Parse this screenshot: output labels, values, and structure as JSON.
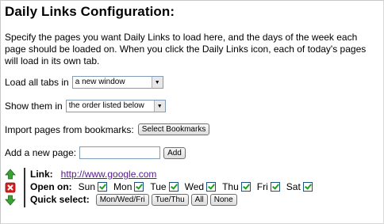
{
  "title": "Daily Links Configuration:",
  "description": "Specify the pages you want Daily Links to load here, and the days of the week each page should be loaded on. When you click the Daily Links icon, each of today's pages will load in its own tab.",
  "load_tabs": {
    "label": "Load all tabs in",
    "selected": "a new window"
  },
  "order": {
    "label": "Show them in",
    "selected": "the order listed below"
  },
  "import": {
    "label": "Import pages from bookmarks:",
    "button": "Select Bookmarks"
  },
  "add_page": {
    "label": "Add a new page:",
    "value": "",
    "button": "Add"
  },
  "entry": {
    "link_label": "Link:",
    "url": "http://www.google.com",
    "open_on_label": "Open on:",
    "days": [
      {
        "name": "Sun",
        "checked": true
      },
      {
        "name": "Mon",
        "checked": true
      },
      {
        "name": "Tue",
        "checked": true
      },
      {
        "name": "Wed",
        "checked": true
      },
      {
        "name": "Thu",
        "checked": true
      },
      {
        "name": "Fri",
        "checked": true
      },
      {
        "name": "Sat",
        "checked": true
      }
    ],
    "quick_select_label": "Quick select:",
    "quick_buttons": [
      "Mon/Wed/Fri",
      "Tue/Thu",
      "All",
      "None"
    ]
  },
  "colors": {
    "arrow_green": "#3aa135",
    "remove_red": "#d42020",
    "link": "#551a8b"
  }
}
